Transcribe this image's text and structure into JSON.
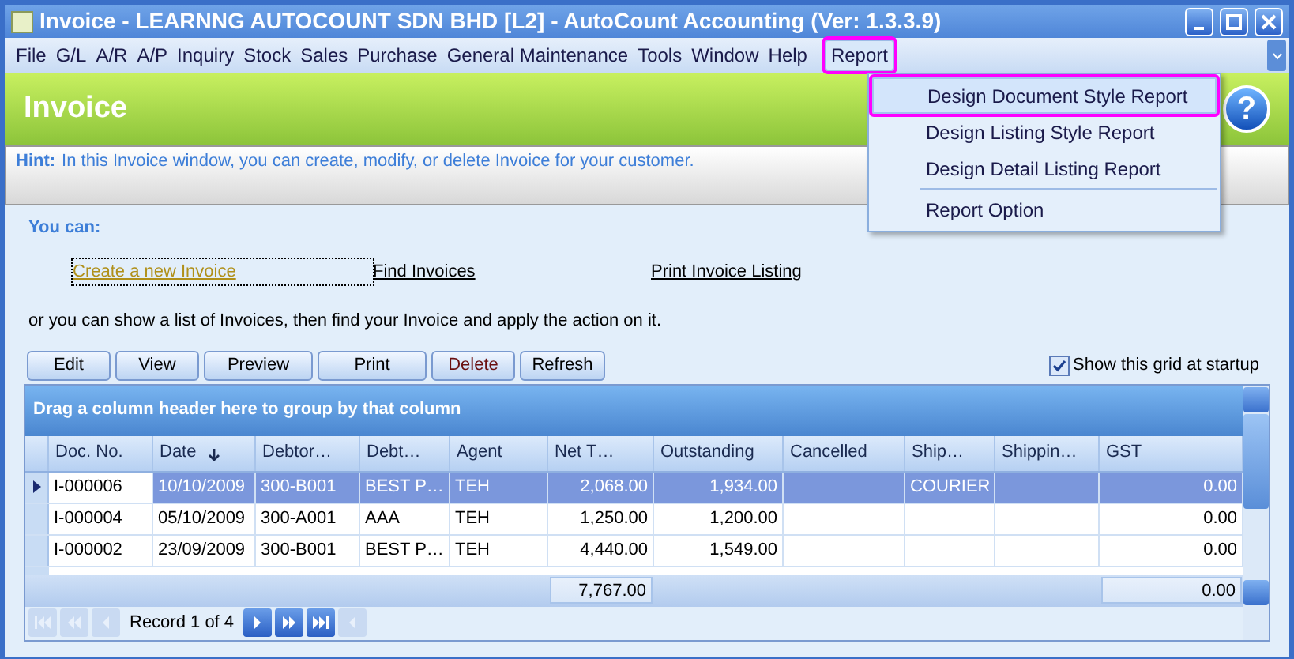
{
  "window": {
    "title": "Invoice - LEARNNG AUTOCOUNT SDN BHD [L2] - AutoCount Accounting (Ver: 1.3.3.9)"
  },
  "menu": [
    {
      "label": "File",
      "open": false
    },
    {
      "label": "G/L",
      "open": false
    },
    {
      "label": "A/R",
      "open": false
    },
    {
      "label": "A/P",
      "open": false
    },
    {
      "label": "Inquiry",
      "open": false
    },
    {
      "label": "Stock",
      "open": false
    },
    {
      "label": "Sales",
      "open": false
    },
    {
      "label": "Purchase",
      "open": false
    },
    {
      "label": "General Maintenance",
      "open": false
    },
    {
      "label": "Tools",
      "open": false
    },
    {
      "label": "Window",
      "open": false
    },
    {
      "label": "Help",
      "open": false
    },
    {
      "label": "Report",
      "open": true
    }
  ],
  "dropdown": [
    {
      "items": [
        {
          "label": "Design Document Style Report",
          "selected": true
        },
        {
          "label": "Design Listing Style Report",
          "selected": false
        },
        {
          "label": "Design Detail Listing Report",
          "selected": false
        }
      ]
    },
    {
      "items": [
        {
          "label": "Report Option",
          "selected": false
        }
      ]
    }
  ],
  "header": {
    "title": "Invoice",
    "help": "?"
  },
  "hint": {
    "label": "Hint:",
    "text": "In this Invoice window, you can create, modify, or delete Invoice for your customer."
  },
  "you_can": "You can:",
  "actions": [
    {
      "label": "Create a new Invoice",
      "focused": true
    },
    {
      "label": "Find Invoices",
      "focused": false
    },
    {
      "label": "Print Invoice Listing",
      "focused": false
    }
  ],
  "instruction": "or you can show a list of Invoices, then find your Invoice and apply the action on it.",
  "buttons": [
    {
      "label": "Edit",
      "disabled": false
    },
    {
      "label": "View",
      "disabled": false
    },
    {
      "label": "Preview",
      "disabled": false
    },
    {
      "label": "Print",
      "disabled": false
    },
    {
      "label": "Delete",
      "disabled": false
    },
    {
      "label": "Refresh",
      "disabled": false
    }
  ],
  "show_grid": {
    "label": "Show this grid at startup",
    "checked": true
  },
  "grid": {
    "group_panel": "Drag a column header here to group by that column",
    "columns": [
      {
        "label": "Doc. No.",
        "sorted": false
      },
      {
        "label": "Date",
        "sorted": true
      },
      {
        "label": "Debtor…",
        "sorted": false
      },
      {
        "label": "Debt…",
        "sorted": false
      },
      {
        "label": "Agent",
        "sorted": false
      },
      {
        "label": "Net T…",
        "sorted": false,
        "total": "7,767.00"
      },
      {
        "label": "Outstanding",
        "sorted": false
      },
      {
        "label": "Cancelled",
        "sorted": false
      },
      {
        "label": "Ship…",
        "sorted": false
      },
      {
        "label": "Shippin…",
        "sorted": false
      },
      {
        "label": "GST",
        "sorted": false,
        "total": "0.00"
      }
    ],
    "rows": [
      {
        "selected": true,
        "cells": [
          "I-000006",
          "10/10/2009",
          "300-B001",
          "BEST P…",
          "TEH",
          "2,068.00",
          "1,934.00",
          "",
          "COURIER",
          "",
          "0.00"
        ]
      },
      {
        "selected": false,
        "cells": [
          "I-000004",
          "05/10/2009",
          "300-A001",
          "AAA",
          "TEH",
          "1,250.00",
          "1,200.00",
          "",
          "",
          "",
          "0.00"
        ]
      },
      {
        "selected": false,
        "cells": [
          "I-000002",
          "23/09/2009",
          "300-B001",
          "BEST P…",
          "TEH",
          "4,440.00",
          "1,549.00",
          "",
          "",
          "",
          "0.00"
        ]
      }
    ],
    "record": "Record 1 of 4",
    "nav": [
      {
        "kind": "first",
        "disabled": true
      },
      {
        "kind": "prev-page",
        "disabled": true
      },
      {
        "kind": "prev",
        "disabled": true
      },
      {
        "kind": "next",
        "disabled": false
      },
      {
        "kind": "next-page",
        "disabled": false
      },
      {
        "kind": "last",
        "disabled": false
      },
      {
        "kind": "scroll-left",
        "disabled": true
      }
    ]
  }
}
